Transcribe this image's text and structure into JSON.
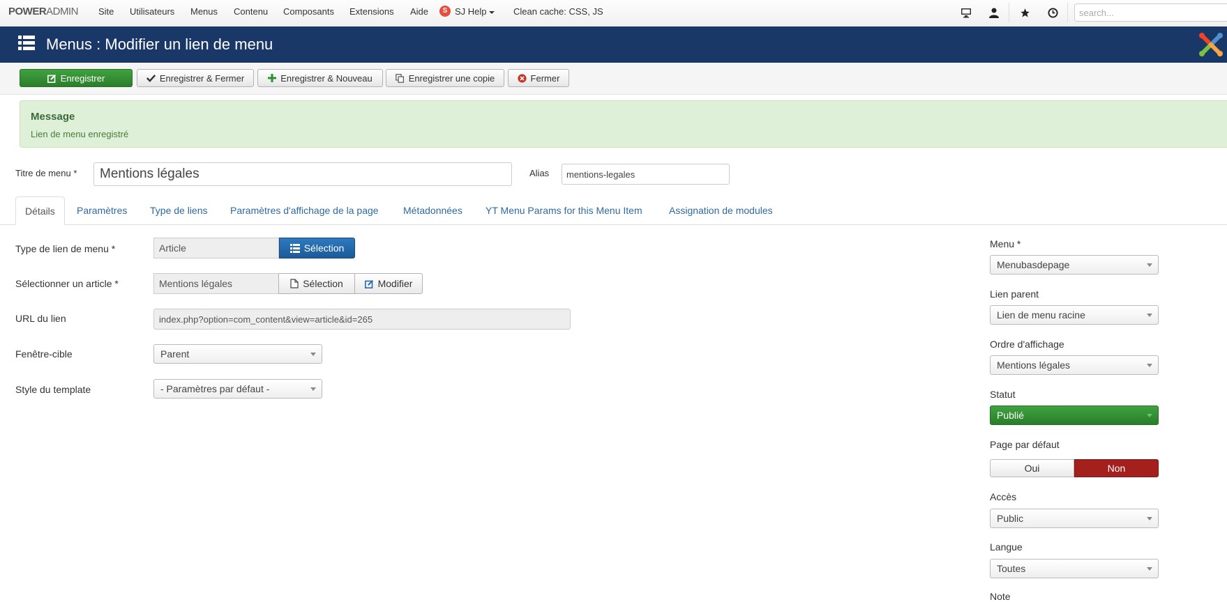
{
  "navbar": {
    "brand_bold": "POWER",
    "brand_light": "ADMIN",
    "items": [
      "Site",
      "Utilisateurs",
      "Menus",
      "Contenu",
      "Composants",
      "Extensions",
      "Aide"
    ],
    "sj_badge": "S",
    "sj_help": "SJ Help",
    "clean_cache": "Clean cache: CSS, JS",
    "icons": [
      "monitor-icon",
      "user-icon",
      "star-icon",
      "clock-icon"
    ],
    "search_placeholder": "search..."
  },
  "header": {
    "title": "Menus : Modifier un lien de menu",
    "icon": "menu-grid-icon",
    "logo": "joomla-logo"
  },
  "toolbar": {
    "save": "Enregistrer",
    "save_close": "Enregistrer & Fermer",
    "save_new": "Enregistrer & Nouveau",
    "save_copy": "Enregistrer une copie",
    "close": "Fermer"
  },
  "alert": {
    "heading": "Message",
    "text": "Lien de menu enregistré"
  },
  "form": {
    "title_label": "Titre de menu *",
    "title_value": "Mentions légales",
    "alias_label": "Alias",
    "alias_value": "mentions-legales"
  },
  "tabs": [
    "Détails",
    "Paramètres",
    "Type de liens",
    "Paramètres d'affichage de la page",
    "Métadonnées",
    "YT Menu Params for this Menu Item",
    "Assignation de modules"
  ],
  "details": {
    "type_label": "Type de lien de menu *",
    "type_value": "Article",
    "type_button": "Sélection",
    "article_label": "Sélectionner un article *",
    "article_value": "Mentions légales",
    "article_select": "Sélection",
    "article_edit": "Modifier",
    "url_label": "URL du lien",
    "url_value": "index.php?option=com_content&view=article&id=265",
    "target_label": "Fenêtre-cible",
    "target_value": "Parent",
    "style_label": "Style du template",
    "style_value": "- Paramètres par défaut -"
  },
  "sidebar": {
    "menu_label": "Menu *",
    "menu_value": "Menubasdepage",
    "parent_label": "Lien parent",
    "parent_value": "Lien de menu racine",
    "order_label": "Ordre d'affichage",
    "order_value": "Mentions légales",
    "status_label": "Statut",
    "status_value": "Publié",
    "default_label": "Page par défaut",
    "default_yes": "Oui",
    "default_no": "Non",
    "access_label": "Accès",
    "access_value": "Public",
    "language_label": "Langue",
    "language_value": "Toutes",
    "note_label": "Note"
  },
  "colors": {
    "header_bg": "#1a3867",
    "success": "#2f8f2f",
    "primary": "#2a6db0",
    "danger": "#a4201d",
    "alert_bg": "#dff0d8"
  }
}
